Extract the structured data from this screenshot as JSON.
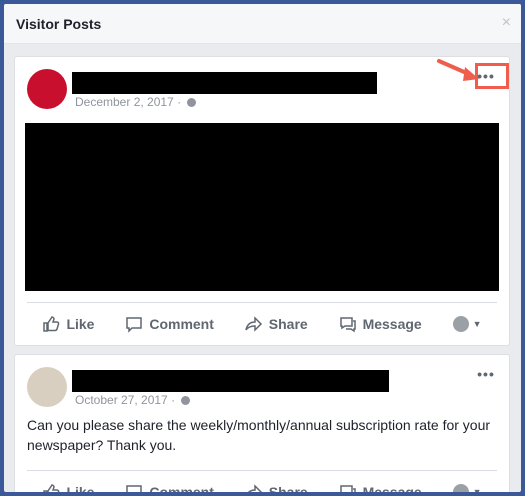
{
  "modal": {
    "title": "Visitor Posts",
    "close_glyph": "×"
  },
  "posts": [
    {
      "date": "December 2, 2017",
      "more_glyph": "•••",
      "actions": {
        "like": "Like",
        "comment": "Comment",
        "share": "Share",
        "message": "Message"
      }
    },
    {
      "date": "October 27, 2017",
      "more_glyph": "•••",
      "text": "Can you please share the weekly/monthly/annual subscription rate for your newspaper? Thank you.",
      "actions": {
        "like": "Like",
        "comment": "Comment",
        "share": "Share",
        "message": "Message"
      }
    }
  ],
  "colors": {
    "frame": "#3b5998",
    "highlight": "#ef5d4c",
    "brand_red": "#c8102e"
  }
}
